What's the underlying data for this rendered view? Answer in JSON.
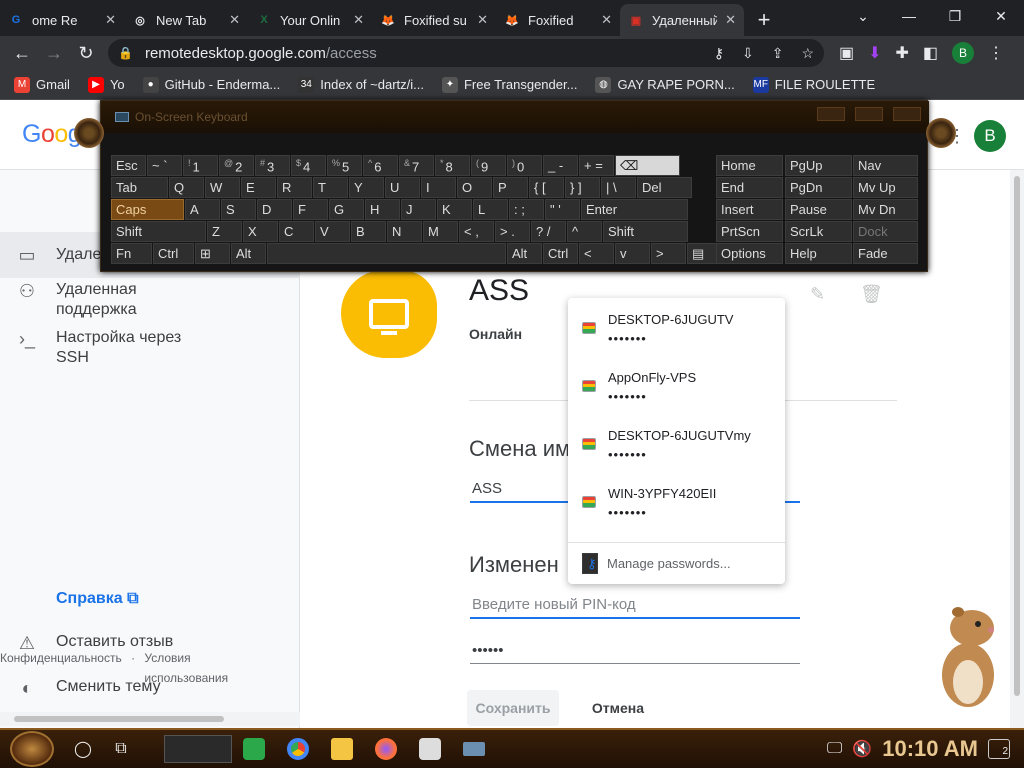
{
  "tabs": [
    {
      "label": "ome Re",
      "icon": "google-account-icon",
      "color": "#1a73e8",
      "glyph": "G"
    },
    {
      "label": "New Tab",
      "icon": "chrome-icon",
      "color": "#e8eaed",
      "glyph": "◎"
    },
    {
      "label": "Your Onlin",
      "icon": "excel-icon",
      "color": "#1d6f42",
      "glyph": "X"
    },
    {
      "label": "Foxified su",
      "icon": "foxified-icon",
      "color": "#e8711c",
      "glyph": "🦊"
    },
    {
      "label": "Foxified",
      "icon": "foxified-icon",
      "color": "#e8711c",
      "glyph": "🦊"
    },
    {
      "label": "Удаленный",
      "icon": "remote-desktop-icon",
      "color": "#d93025",
      "glyph": "▣",
      "active": true
    }
  ],
  "address": {
    "domain": "remotedesktop.google.com",
    "path": "/access"
  },
  "profile_initial": "B",
  "bookmarks": [
    {
      "label": "Gmail",
      "icon": "gmail-icon",
      "color": "#ea4335",
      "glyph": "M"
    },
    {
      "label": "Yo",
      "icon": "youtube-icon",
      "color": "#ff0000",
      "glyph": "▶"
    },
    {
      "label": "GitHub - Enderma...",
      "icon": "github-icon",
      "color": "#444",
      "glyph": "●"
    },
    {
      "label": "Index of ~dartz/i...",
      "icon": "index-icon",
      "color": "#333",
      "glyph": "34"
    },
    {
      "label": "Free Transgender...",
      "icon": "site-icon",
      "color": "#555",
      "glyph": "✦"
    },
    {
      "label": "GAY RAPE PORN...",
      "icon": "globe-icon",
      "color": "#555",
      "glyph": "◍"
    },
    {
      "label": "FILE ROULETTE",
      "icon": "file-roulette-icon",
      "color": "#1a3aa0",
      "glyph": "MF"
    }
  ],
  "header": {
    "logo": "Google",
    "account_initial": "B"
  },
  "sidebar": {
    "items": [
      {
        "label": "Удаленный доступ",
        "icon": "computer-icon",
        "glyph": "▭"
      },
      {
        "label": "Удаленная поддержка",
        "icon": "people-icon",
        "glyph": "👥"
      },
      {
        "label": "Настройка через SSH",
        "icon": "terminal-icon",
        "glyph": "›_"
      }
    ],
    "help": "Справка",
    "feedback": "Оставить отзыв",
    "theme": "Сменить тему",
    "privacy": "Конфиденциальность",
    "dot": "·",
    "terms": "Условия использования"
  },
  "device": {
    "name": "ASS",
    "status": "Онлайн",
    "rename_title": "Смена им",
    "name_value": "ASS",
    "pin_title": "Изменен",
    "pin_placeholder": "Введите новый PIN-код",
    "pin_value": "••••••",
    "save": "Сохранить",
    "cancel": "Отмена"
  },
  "password_popup": {
    "items": [
      {
        "user": "DESKTOP-6JUGUTV",
        "pw": "•••••••"
      },
      {
        "user": "AppOnFly-VPS",
        "pw": "•••••••"
      },
      {
        "user": "DESKTOP-6JUGUTVmy",
        "pw": "•••••••"
      },
      {
        "user": "WIN-3YPFY420EII",
        "pw": "•••••••"
      }
    ],
    "manage": "Manage passwords..."
  },
  "osk": {
    "title": "On-Screen Keyboard",
    "rows": [
      [
        {
          "l": "Esc"
        },
        {
          "l": "~ `"
        },
        {
          "l": "1",
          "s": "!"
        },
        {
          "l": "2",
          "s": "@"
        },
        {
          "l": "3",
          "s": "#"
        },
        {
          "l": "4",
          "s": "$"
        },
        {
          "l": "5",
          "s": "%"
        },
        {
          "l": "6",
          "s": "^"
        },
        {
          "l": "7",
          "s": "&"
        },
        {
          "l": "8",
          "s": "*"
        },
        {
          "l": "9",
          "s": "("
        },
        {
          "l": "0",
          "s": ")"
        },
        {
          "l": "_ -"
        },
        {
          "l": "+ ="
        },
        {
          "l": "⌫",
          "lt": true
        }
      ],
      [
        {
          "l": "Tab"
        },
        {
          "l": "Q"
        },
        {
          "l": "W"
        },
        {
          "l": "E"
        },
        {
          "l": "R"
        },
        {
          "l": "T"
        },
        {
          "l": "Y"
        },
        {
          "l": "U"
        },
        {
          "l": "I"
        },
        {
          "l": "O"
        },
        {
          "l": "P"
        },
        {
          "l": "{ ["
        },
        {
          "l": "} ]"
        },
        {
          "l": "| \\"
        },
        {
          "l": "Del"
        }
      ],
      [
        {
          "l": "Caps",
          "hl": true
        },
        {
          "l": "A"
        },
        {
          "l": "S"
        },
        {
          "l": "D"
        },
        {
          "l": "F"
        },
        {
          "l": "G"
        },
        {
          "l": "H"
        },
        {
          "l": "J"
        },
        {
          "l": "K"
        },
        {
          "l": "L"
        },
        {
          "l": ": ;"
        },
        {
          "l": "\" '"
        },
        {
          "l": "Enter"
        }
      ],
      [
        {
          "l": "Shift"
        },
        {
          "l": "Z"
        },
        {
          "l": "X"
        },
        {
          "l": "C"
        },
        {
          "l": "V"
        },
        {
          "l": "B"
        },
        {
          "l": "N"
        },
        {
          "l": "M"
        },
        {
          "l": "< ,"
        },
        {
          "l": "> ."
        },
        {
          "l": "? /"
        },
        {
          "l": "^"
        },
        {
          "l": "Shift"
        }
      ],
      [
        {
          "l": "Fn"
        },
        {
          "l": "Ctrl"
        },
        {
          "l": "⊞"
        },
        {
          "l": "Alt"
        },
        {
          "l": ""
        },
        {
          "l": "Alt"
        },
        {
          "l": "Ctrl"
        },
        {
          "l": "<"
        },
        {
          "l": "v"
        },
        {
          "l": ">"
        },
        {
          "l": "▤"
        }
      ]
    ],
    "right": [
      [
        "Home",
        "PgUp",
        "Nav"
      ],
      [
        "End",
        "PgDn",
        "Mv Up"
      ],
      [
        "Insert",
        "Pause",
        "Mv Dn"
      ],
      [
        "PrtScn",
        "ScrLk",
        "Dock"
      ],
      [
        "Options",
        "Help",
        "Fade"
      ]
    ]
  },
  "taskbar": {
    "time": "10:10 AM",
    "notifications": "2"
  }
}
